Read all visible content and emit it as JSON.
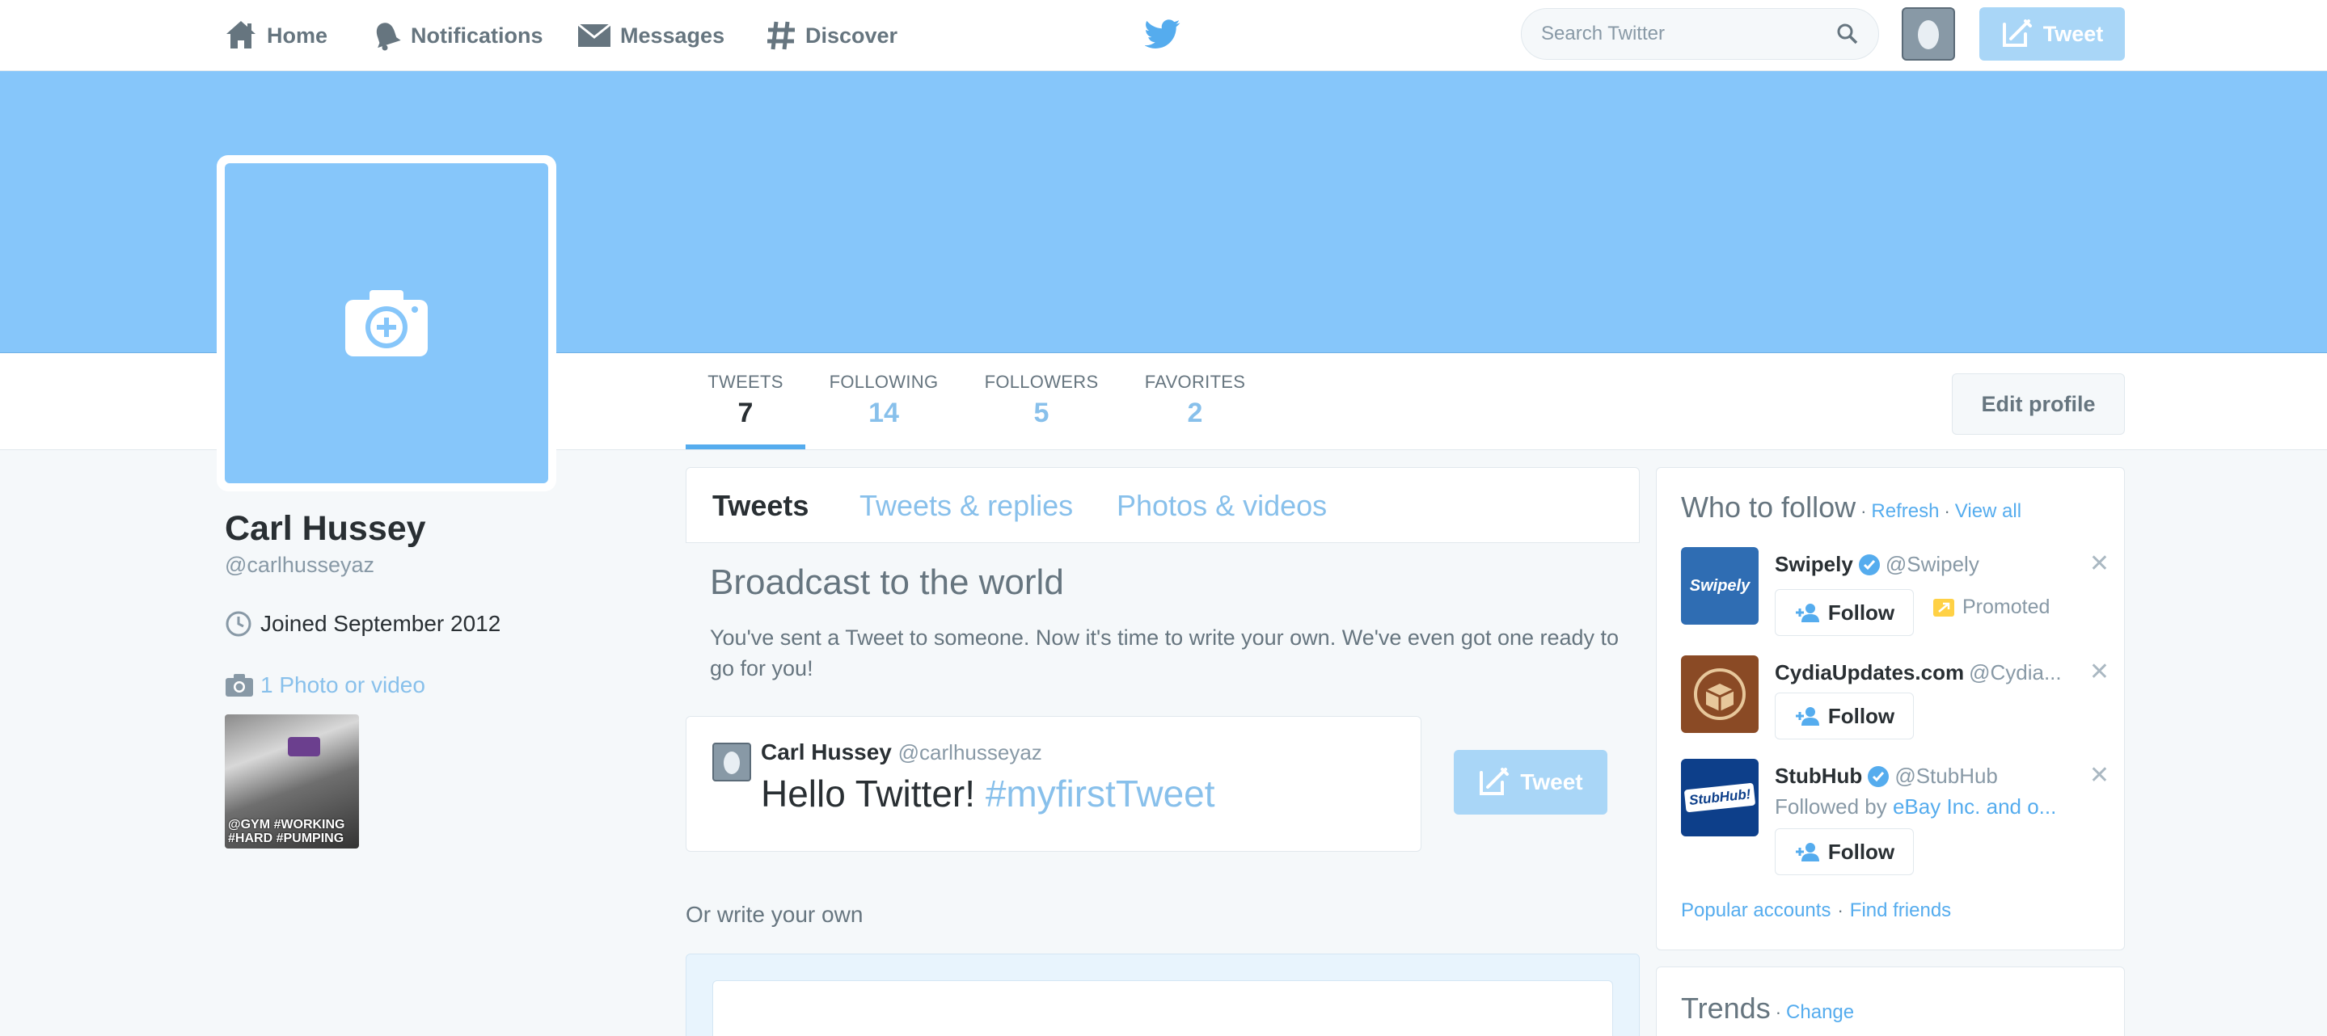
{
  "nav": {
    "home": "Home",
    "notifications": "Notifications",
    "messages": "Messages",
    "discover": "Discover",
    "search_placeholder": "Search Twitter",
    "tweet_button": "Tweet"
  },
  "colors": {
    "brand_blue": "#55acee",
    "header_blue": "#86c6fa",
    "link_blue": "#88c0eb",
    "tweet_button_disabled": "#a9d6f7",
    "promoted_yellow": "#ffd145"
  },
  "icons": {
    "home": "home-icon",
    "notifications": "bell-icon",
    "messages": "envelope-icon",
    "discover": "hashtag-icon",
    "logo": "twitter-bird-icon",
    "search": "search-icon",
    "compose": "compose-icon",
    "camera": "camera-add-icon",
    "clock": "clock-icon",
    "verified": "verified-badge-icon",
    "close": "close-icon",
    "follow": "add-user-icon"
  },
  "profile": {
    "name": "Carl Hussey",
    "handle": "@carlhusseyaz",
    "joined": "Joined September 2012",
    "photos_link": "1 Photo or video",
    "thumbnail_caption": "@GYM #WORKING #HARD #PUMPING",
    "edit_profile": "Edit profile"
  },
  "stats": [
    {
      "label": "TWEETS",
      "value": "7"
    },
    {
      "label": "FOLLOWING",
      "value": "14"
    },
    {
      "label": "FOLLOWERS",
      "value": "5"
    },
    {
      "label": "FAVORITES",
      "value": "2"
    }
  ],
  "timeline": {
    "tabs": [
      "Tweets",
      "Tweets & replies",
      "Photos & videos"
    ],
    "broadcast_title": "Broadcast to the world",
    "broadcast_text": "You've sent a Tweet to someone. Now it's time to write your own. We've even got one ready to go for you!",
    "suggested_tweet": {
      "name": "Carl Hussey",
      "handle": "@carlhusseyaz",
      "text": "Hello Twitter!",
      "hashtag": "#myfirstTweet"
    },
    "tweet_button": "Tweet",
    "or_write": "Or write your own"
  },
  "who_to_follow": {
    "title": "Who to follow",
    "refresh": "Refresh",
    "view_all": "View all",
    "items": [
      {
        "name": "Swipely",
        "handle": "@Swipely",
        "avatar_text": "Swipely",
        "follow": "Follow",
        "promoted": "Promoted",
        "verified": true
      },
      {
        "name": "CydiaUpdates.com",
        "handle": "@Cydia...",
        "follow": "Follow",
        "verified": false
      },
      {
        "name": "StubHub",
        "handle": "@StubHub",
        "avatar_text": "StubHub!",
        "followed_by_prefix": "Followed by",
        "followed_by_account": "eBay Inc.",
        "followed_by_suffix": "and o...",
        "follow": "Follow",
        "verified": true
      }
    ],
    "popular_accounts": "Popular accounts",
    "find_friends": "Find friends"
  },
  "trends": {
    "title": "Trends",
    "change": "Change"
  }
}
